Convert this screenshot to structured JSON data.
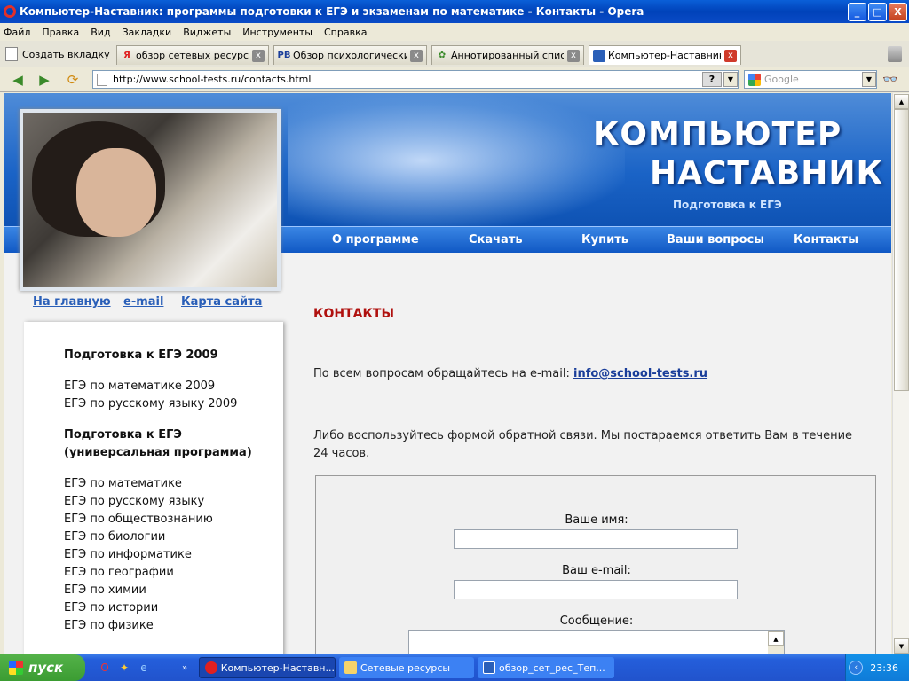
{
  "window": {
    "title": "Компьютер-Наставник: программы подготовки к ЕГЭ и экзаменам по математике - Контакты - Opera",
    "buttons": {
      "minimize": "_",
      "maximize": "□",
      "close": "X"
    }
  },
  "menu": [
    "Файл",
    "Правка",
    "Вид",
    "Закладки",
    "Виджеты",
    "Инструменты",
    "Справка"
  ],
  "tabs": {
    "new_tab_label": "Создать вкладку",
    "items": [
      {
        "label": "обзор сетевых ресурсо...",
        "favicon": "Я",
        "favicon_color": "#e02020"
      },
      {
        "label": "Обзор психологически...",
        "favicon": "PB",
        "favicon_color": "#1a3e9a"
      },
      {
        "label": "Аннотированный списо...",
        "favicon": "✿",
        "favicon_color": "#3a8a2a"
      },
      {
        "label": "Компьютер-Наставник:...",
        "favicon": "",
        "favicon_color": "#2a5fb8",
        "active": true
      }
    ],
    "close_glyph": "x"
  },
  "address": {
    "url": "http://www.school-tests.ru/contacts.html",
    "help_glyph": "?",
    "search_placeholder": "Google"
  },
  "site": {
    "brand_line1": "КОМПЬЮТЕР",
    "brand_line2": "НАСТАВНИК",
    "brand_sub": "Подготовка к ЕГЭ",
    "nav": [
      "О программе",
      "Скачать",
      "Купить",
      "Ваши вопросы",
      "Контакты"
    ],
    "sublinks": [
      "На главную",
      "e-mail",
      "Карта сайта"
    ]
  },
  "sidebar": {
    "section1": "Подготовка к ЕГЭ 2009",
    "items1": [
      "ЕГЭ по математике 2009",
      "ЕГЭ по русскому языку 2009"
    ],
    "section2_line1": "Подготовка к ЕГЭ",
    "section2_line2": "(универсальная программа)",
    "items2": [
      "ЕГЭ по математике",
      "ЕГЭ по русскому языку",
      "ЕГЭ по обществознанию",
      "ЕГЭ по биологии",
      "ЕГЭ по информатике",
      "ЕГЭ по географии",
      "ЕГЭ по химии",
      "ЕГЭ по истории",
      "ЕГЭ по физике"
    ]
  },
  "content": {
    "title": "КОНТАКТЫ",
    "email_text": "По всем вопросам обращайтесь на e-mail: ",
    "email": "info@school-tests.ru",
    "form_text_line1": "Либо воспользуйтесь формой обратной связи. Мы постараемся ответить Вам в течение",
    "form_text_line2": "24 часов.",
    "form": {
      "name_label": "Ваше имя:",
      "email_label": "Ваш e-mail:",
      "message_label": "Сообщение:",
      "name_value": "",
      "email_value": "",
      "message_value": ""
    }
  },
  "taskbar": {
    "start_label": "пуск",
    "tasks": [
      {
        "label": "Компьютер-Наставн...",
        "active": true
      },
      {
        "label": "Сетевые ресурсы",
        "active": false
      },
      {
        "label": "обзор_сет_рес_Теп...",
        "active": false
      }
    ],
    "clock": "23:36"
  }
}
